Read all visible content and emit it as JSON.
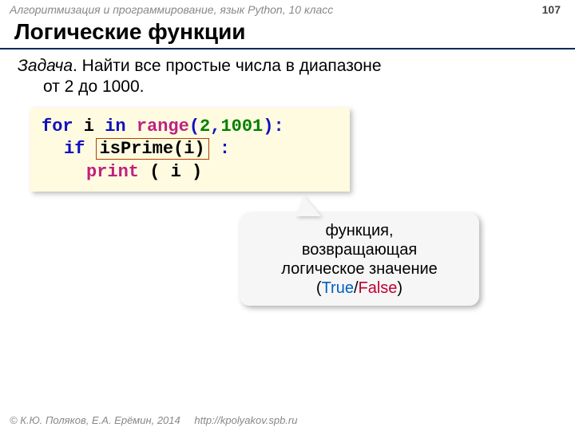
{
  "header": {
    "course": "Алгоритмизация и программирование, язык Python, 10 класс",
    "page": "107"
  },
  "title": "Логические функции",
  "problem": {
    "label": "Задача",
    "text1": ". Найти все простые числа в диапазоне",
    "text2": "от 2 до 1000."
  },
  "code": {
    "kw_for": "for",
    "var_i1": " i ",
    "kw_in": "in",
    "sp1": " ",
    "fn_range": "range",
    "lp1": "(",
    "n2": "2",
    "comma": ",",
    "n1001": "1001",
    "rp1": ")",
    "colon1": ":",
    "kw_if": "if",
    "sp2": " ",
    "isprime_call": "isPrime(i)",
    "sp3": " ",
    "colon2": ":",
    "fn_print": "print",
    "sp4": " ",
    "args_i": "( i )"
  },
  "callout": {
    "line1": "функция,",
    "line2": "возвращающая",
    "line3": "логическое значение",
    "lp": "(",
    "true": "True",
    "slash": "/",
    "false": "False",
    "rp": ")"
  },
  "footer": {
    "copyright": "© К.Ю. Поляков, Е.А. Ерёмин, 2014",
    "url": "http://kpolyakov.spb.ru"
  }
}
